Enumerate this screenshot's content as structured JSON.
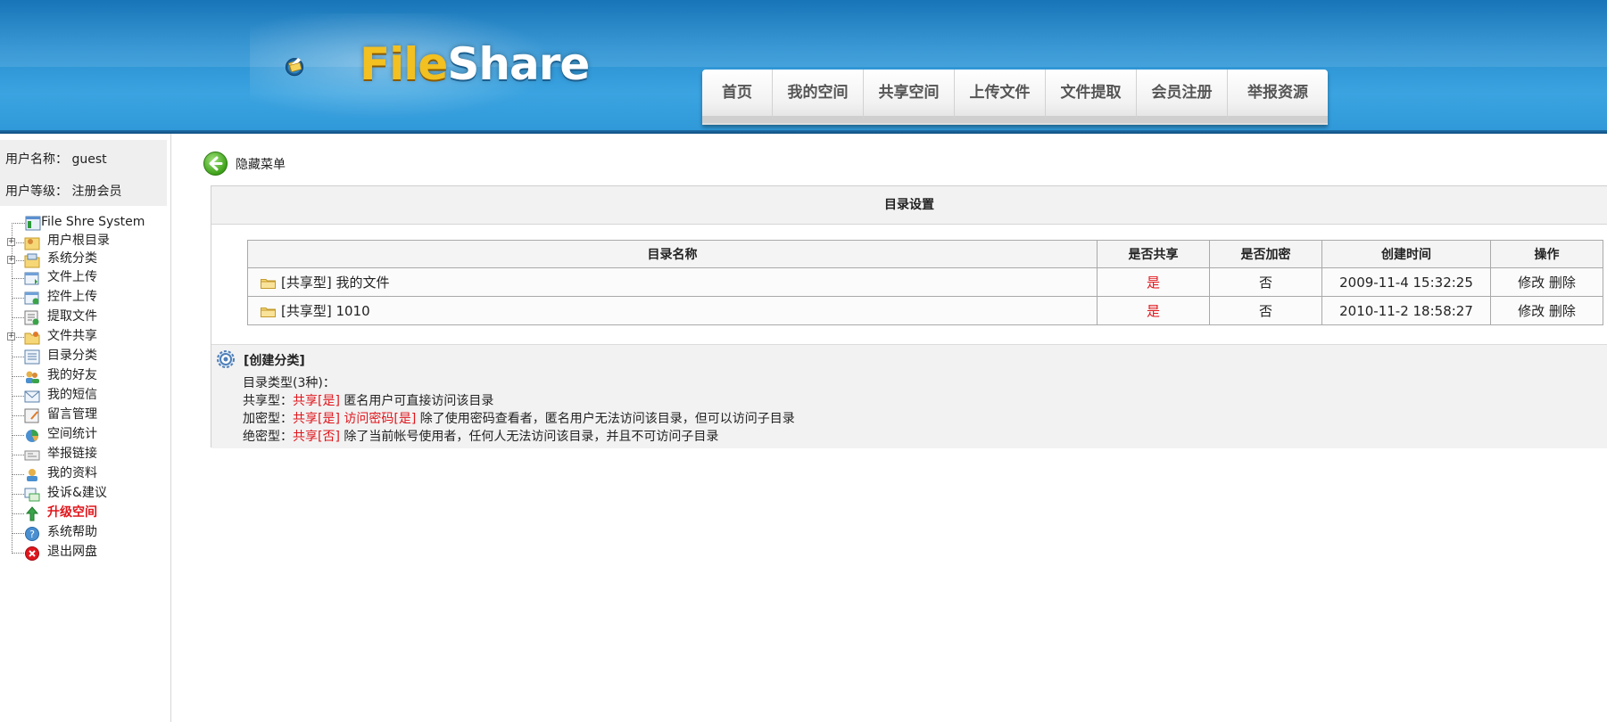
{
  "header": {
    "logo_file": "File",
    "logo_share": "Share",
    "nav": [
      "首页",
      "我的空间",
      "共享空间",
      "上传文件",
      "文件提取",
      "会员注册",
      "举报资源"
    ]
  },
  "user": {
    "name_label": "用户名称：",
    "name_value": "guest",
    "level_label": "用户等级：",
    "level_value": "注册会员"
  },
  "tree": {
    "root": "File Shre System",
    "items": [
      {
        "label": "用户根目录",
        "icon": "user-folder-icon",
        "expandable": true
      },
      {
        "label": "系统分类",
        "icon": "folder-icon",
        "expandable": true
      },
      {
        "label": "文件上传",
        "icon": "upload-icon",
        "expandable": false
      },
      {
        "label": "控件上传",
        "icon": "control-upload-icon",
        "expandable": false
      },
      {
        "label": "提取文件",
        "icon": "extract-icon",
        "expandable": false
      },
      {
        "label": "文件共享",
        "icon": "share-folder-icon",
        "expandable": true
      },
      {
        "label": "目录分类",
        "icon": "list-icon",
        "expandable": false
      },
      {
        "label": "我的好友",
        "icon": "friends-icon",
        "expandable": false
      },
      {
        "label": "我的短信",
        "icon": "message-icon",
        "expandable": false
      },
      {
        "label": "留言管理",
        "icon": "guestbook-icon",
        "expandable": false
      },
      {
        "label": "空间统计",
        "icon": "pie-chart-icon",
        "expandable": false
      },
      {
        "label": "举报链接",
        "icon": "report-icon",
        "expandable": false
      },
      {
        "label": "我的资料",
        "icon": "profile-icon",
        "expandable": false
      },
      {
        "label": "投诉&建议",
        "icon": "feedback-icon",
        "expandable": false
      },
      {
        "label": "升级空间",
        "icon": "upgrade-icon",
        "expandable": false,
        "highlight": true
      },
      {
        "label": "系统帮助",
        "icon": "help-icon",
        "expandable": false
      },
      {
        "label": "退出网盘",
        "icon": "exit-icon",
        "expandable": false
      }
    ]
  },
  "main": {
    "hide_menu": "隐藏菜单",
    "panel_title": "目录设置",
    "columns": [
      "目录名称",
      "是否共享",
      "是否加密",
      "创建时间",
      "操作"
    ],
    "rows": [
      {
        "name": "[共享型] 我的文件",
        "shared": "是",
        "encrypted": "否",
        "created": "2009-11-4 15:32:25",
        "edit": "修改",
        "delete": "删除"
      },
      {
        "name": "[共享型] 1010",
        "shared": "是",
        "encrypted": "否",
        "created": "2010-11-2 18:58:27",
        "edit": "修改",
        "delete": "删除"
      }
    ],
    "create": {
      "title": "[创建分类]",
      "types_line": "目录类型(3种)：",
      "shared_type": {
        "prefix": "共享型：",
        "tag": "共享[是]",
        "desc": " 匿名用户可直接访问该目录"
      },
      "encrypted_type": {
        "prefix": "加密型：",
        "tag1": "共享[是]",
        "tag2": "访问密码[是]",
        "desc": " 除了使用密码查看者，匿名用户无法访问该目录，但可以访问子目录"
      },
      "private_type": {
        "prefix": "绝密型：",
        "tag": "共享[否]",
        "desc": " 除了当前帐号使用者，任何人无法访问该目录，并且不可访问子目录"
      }
    }
  },
  "colors": {
    "accent_red": "#e0161c",
    "header_blue": "#2a8fd0"
  }
}
